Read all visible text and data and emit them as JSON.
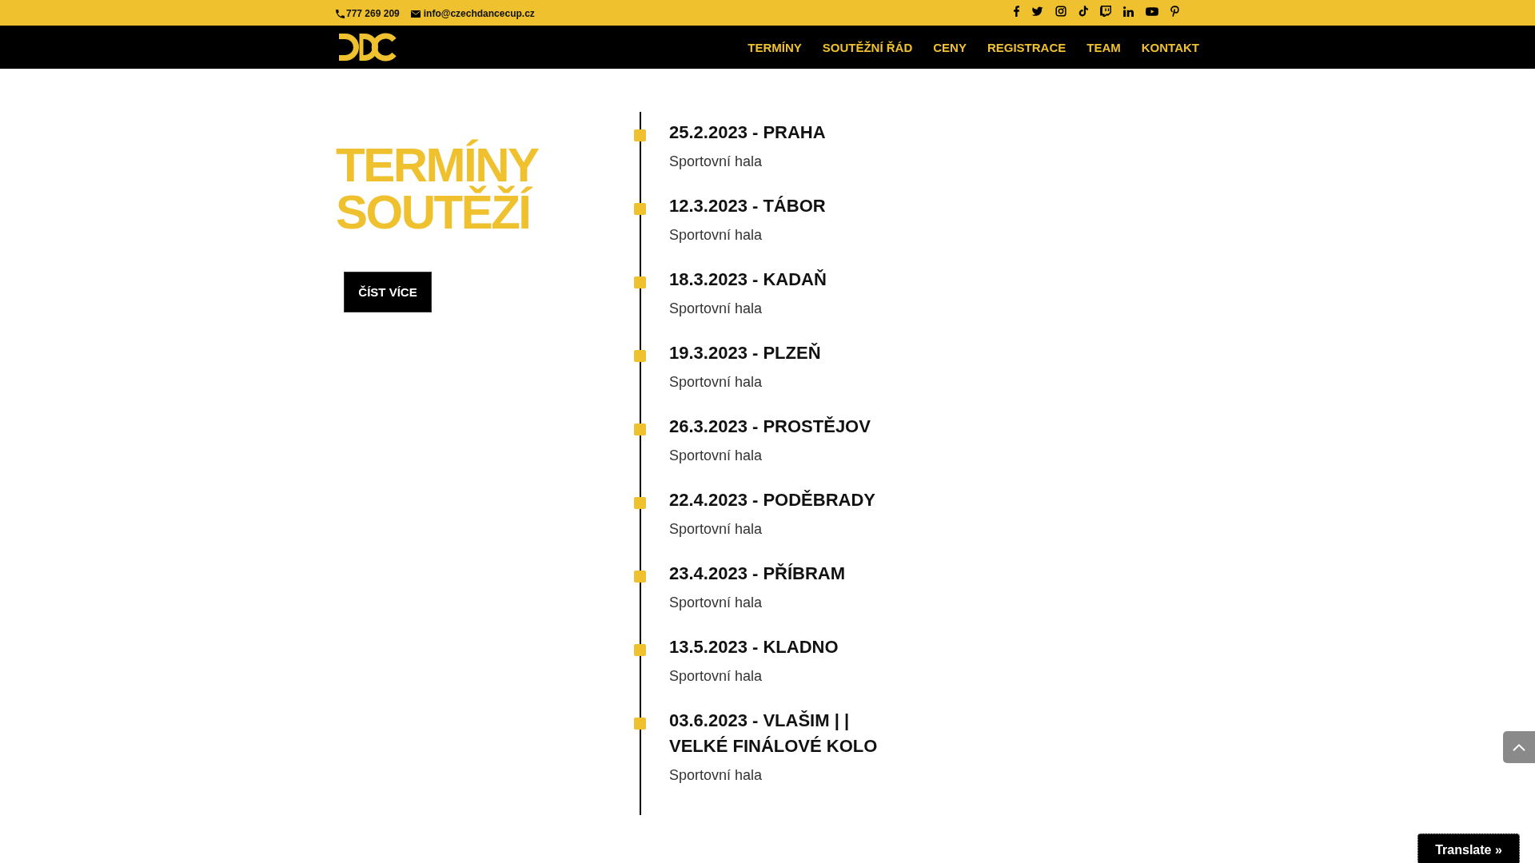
{
  "top_bar": {
    "phone": "777 269 209",
    "email": "info@czechdancecup.cz"
  },
  "header": {
    "nav": [
      "TERMÍNY",
      "SOUTĚŽNÍ ŘÁD",
      "CENY",
      "REGISTRACE",
      "TEAM",
      "KONTAKT"
    ]
  },
  "intro": {
    "title": "TERMÍNY SOUTĚŽÍ",
    "button": "ČÍST VÍCE"
  },
  "events": [
    {
      "title": "25.2.2023 - PRAHA",
      "venue": "Sportovní hala"
    },
    {
      "title": "12.3.2023 - TÁBOR",
      "venue": "Sportovní hala"
    },
    {
      "title": "18.3.2023 - KADAŇ",
      "venue": "Sportovní hala"
    },
    {
      "title": "19.3.2023 - PLZEŇ",
      "venue": "Sportovní hala"
    },
    {
      "title": "26.3.2023 - PROSTĚJOV",
      "venue": "Sportovní hala"
    },
    {
      "title": "22.4.2023 - PODĚBRADY",
      "venue": "Sportovní hala"
    },
    {
      "title": "23.4.2023 - PŘÍBRAM",
      "venue": "Sportovní hala"
    },
    {
      "title": "13.5.2023 - KLADNO",
      "venue": "Sportovní hala"
    },
    {
      "title": "03.6.2023 - VLAŠIM | | VELKÉ FINÁLOVÉ KOLO",
      "venue": "Sportovní hala"
    }
  ],
  "translate_button": "Translate »"
}
